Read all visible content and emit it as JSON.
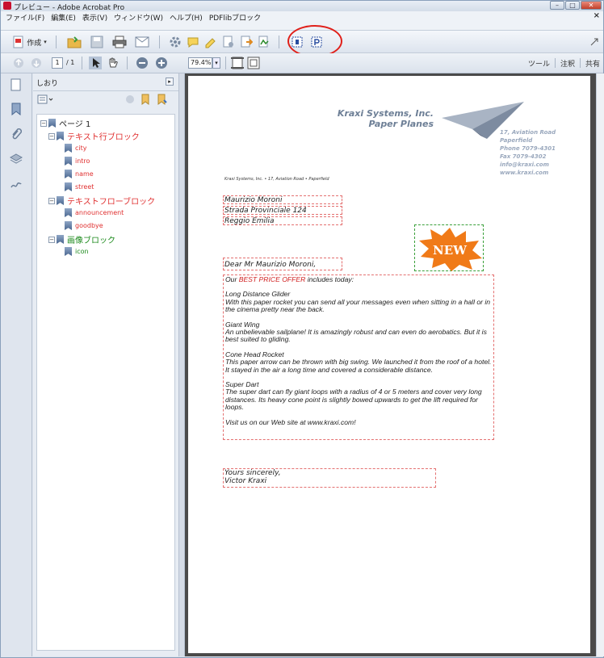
{
  "window": {
    "title": "プレビュー - Adobe Acrobat Pro",
    "min": "–",
    "max": "□",
    "close": "✕"
  },
  "menu": {
    "items": [
      "ファイル(F)",
      "編集(E)",
      "表示(V)",
      "ウィンドウ(W)",
      "ヘルプ(H)",
      "PDFlibブロック"
    ],
    "close": "×"
  },
  "toolbar": {
    "create_label": "作成"
  },
  "nav": {
    "page_current": "1",
    "page_total": "/ 1",
    "zoom": "79.4%",
    "tools": "ツール",
    "comment": "注釈",
    "share": "共有"
  },
  "bookmarks": {
    "title": "しおり",
    "page": "ページ 1",
    "groups": [
      {
        "label": "テキスト行ブロック",
        "color": "#e03030",
        "items": [
          "city",
          "intro",
          "name",
          "street"
        ]
      },
      {
        "label": "テキストフローブロック",
        "color": "#e03030",
        "items": [
          "announcement",
          "goodbye"
        ]
      },
      {
        "label": "画像ブロック",
        "color": "#1c8a1c",
        "items": [
          "icon"
        ]
      }
    ]
  },
  "document": {
    "company_name": "Kraxi Systems, Inc.",
    "company_tagline": "Paper Planes",
    "contact": [
      "17, Aviation Road",
      "Paperfield",
      "Phone 7079-4301",
      "Fax 7079-4302",
      "info@kraxi.com",
      "www.kraxi.com"
    ],
    "sender_line": "Kraxi Systems, Inc. • 17, Aviation Road • Paperfield",
    "recipient_name": "Maurizio Moroni",
    "street": "Strada Provinciale 124",
    "city": "Reggio Emilia",
    "badge": "NEW",
    "salutation": "Dear Mr Maurizio Moroni,",
    "offer_prefix": "Our ",
    "offer_highlight": "BEST PRICE OFFER",
    "offer_suffix": " includes today:",
    "products": [
      {
        "name": "Long Distance Glider",
        "desc": "With this paper rocket you can send all your messages even when sitting in a hall or in the cinema pretty near the back."
      },
      {
        "name": "Giant Wing",
        "desc": "An unbelievable sailplane! It is amazingly robust and can even do aerobatics. But it is best suited to gliding."
      },
      {
        "name": "Cone Head Rocket",
        "desc": "This paper arrow can be thrown with big swing. We launched it from the roof of a hotel. It stayed in the air a long time and covered a considerable distance."
      },
      {
        "name": "Super Dart",
        "desc": "The super dart can fly giant loops with a radius of 4 or 5 meters and cover very long distances. Its heavy cone point is slightly bowed upwards to get the lift required for loops."
      }
    ],
    "visit": "Visit us on our Web site at www.kraxi.com!",
    "closing": "Yours sincerely,",
    "signature": "Victor Kraxi"
  },
  "colors": {
    "block_border": "#e47070",
    "image_block_border": "#3aa03a",
    "highlight_circle": "#e0201a",
    "badge": "#f07a18"
  }
}
